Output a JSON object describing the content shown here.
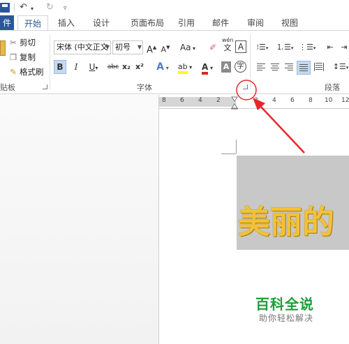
{
  "quick_access": {
    "save_icon": "save-icon",
    "undo_icon": "undo-icon",
    "redo_icon": "redo-icon",
    "customize_icon": "customize-icon"
  },
  "tabs": [
    {
      "label": "件"
    },
    {
      "label": "开始"
    },
    {
      "label": "插入"
    },
    {
      "label": "设计"
    },
    {
      "label": "页面布局"
    },
    {
      "label": "引用"
    },
    {
      "label": "邮件"
    },
    {
      "label": "审阅"
    },
    {
      "label": "视图"
    }
  ],
  "clipboard": {
    "cut": "剪切",
    "copy": "复制",
    "format_painter": "格式刷",
    "group_label": "贴板"
  },
  "font": {
    "font_name": "宋体 (中文正文",
    "font_size": "初号",
    "grow": "A",
    "shrink": "A",
    "case": "Aa",
    "clear": "清",
    "phonetic_top": "wén",
    "phonetic_bottom": "文",
    "char_border": "A",
    "bold": "B",
    "italic": "I",
    "underline": "U",
    "strikethrough": "abc",
    "subscript": "x₂",
    "superscript": "x²",
    "effects": "A",
    "highlight": "ab",
    "font_color": "A",
    "shading": "A",
    "enclosed": "字",
    "group_label": "字体"
  },
  "paragraph": {
    "group_label": "段落"
  },
  "ruler": {
    "numbers": [
      "8",
      "6",
      "4",
      "2",
      "2",
      "4",
      "6",
      "8",
      "10",
      "12"
    ]
  },
  "document": {
    "text": "美丽的"
  },
  "watermark": {
    "title": "百科全说",
    "subtitle": "助你轻松解决"
  },
  "colors": {
    "accent": "#2b579a",
    "highlight_yellow": "#ffff00",
    "font_red": "#e0262a",
    "annotation_red": "#e8262a",
    "watermark_green": "#1aa035",
    "gold_text": "#f1c238"
  }
}
